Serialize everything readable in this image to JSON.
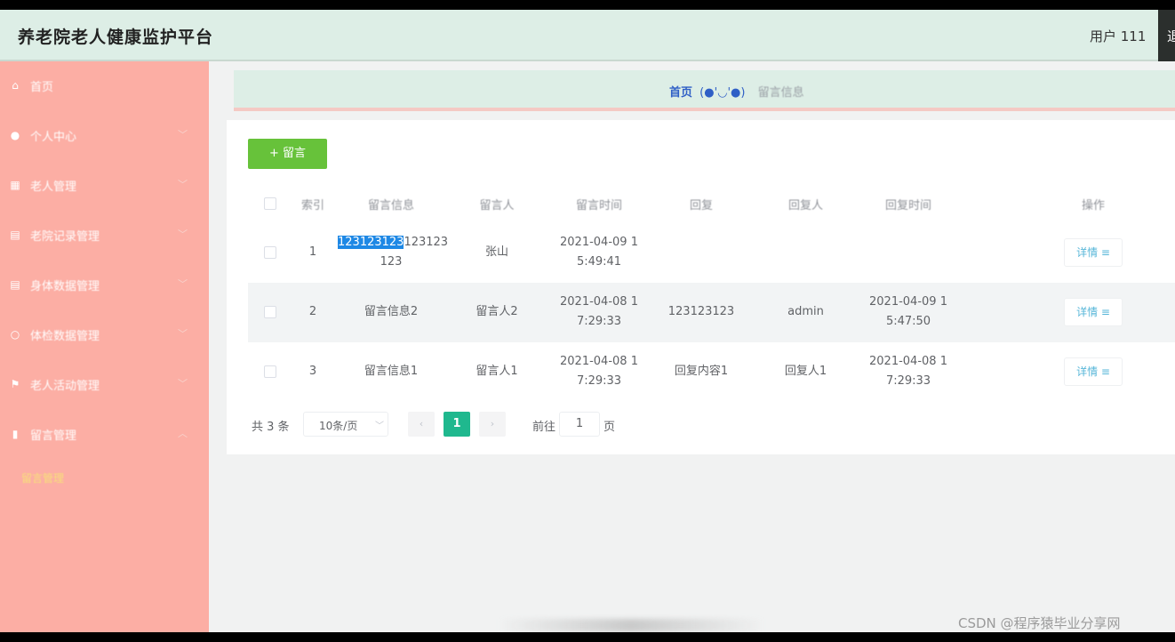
{
  "header": {
    "app_title": "养老院老人健康监护平台",
    "user_label": "用户 111",
    "logout_label": "退"
  },
  "sidebar": {
    "items": [
      {
        "label": "首页",
        "icon": "home-icon",
        "glyph": "⌂"
      },
      {
        "label": "个人中心",
        "icon": "user-icon",
        "glyph": "●"
      },
      {
        "label": "老人管理",
        "icon": "grid-icon",
        "glyph": "▦"
      },
      {
        "label": "老院记录管理",
        "icon": "document-icon",
        "glyph": "▤"
      },
      {
        "label": "身体数据管理",
        "icon": "document-icon",
        "glyph": "▤"
      },
      {
        "label": "体检数据管理",
        "icon": "circle-icon",
        "glyph": "○"
      },
      {
        "label": "老人活动管理",
        "icon": "flag-icon",
        "glyph": "⚑"
      },
      {
        "label": "留言管理",
        "icon": "chart-icon",
        "glyph": "▮"
      }
    ],
    "sub_item": "留言管理"
  },
  "breadcrumb": {
    "home": "首页",
    "face": "(●'◡'●)",
    "current": "留言信息"
  },
  "toolbar": {
    "add_label": "+ 留言"
  },
  "table": {
    "columns": [
      "索引",
      "留言信息",
      "留言人",
      "留言时间",
      "回复",
      "回复人",
      "回复时间",
      "操作"
    ],
    "rows": [
      {
        "index": "1",
        "message_sel": "123123123",
        "message_rest": "123123",
        "message_line2": "123",
        "author": "张山",
        "time1": "2021-04-09 1",
        "time2": "5:49:41",
        "reply": "",
        "replier": "",
        "rtime1": "",
        "rtime2": "",
        "action": "详情 ≡"
      },
      {
        "index": "2",
        "message_sel": "",
        "message_rest": "留言信息2",
        "message_line2": "",
        "author": "留言人2",
        "time1": "2021-04-08 1",
        "time2": "7:29:33",
        "reply": "123123123",
        "replier": "admin",
        "rtime1": "2021-04-09 1",
        "rtime2": "5:47:50",
        "action": "详情 ≡"
      },
      {
        "index": "3",
        "message_sel": "",
        "message_rest": "留言信息1",
        "message_line2": "",
        "author": "留言人1",
        "time1": "2021-04-08 1",
        "time2": "7:29:33",
        "reply": "回复内容1",
        "replier": "回复人1",
        "rtime1": "2021-04-08 1",
        "rtime2": "7:29:33",
        "action": "详情 ≡"
      }
    ]
  },
  "pagination": {
    "total": "共 3 条",
    "page_size": "10条/页",
    "current_page": "1",
    "goto_label": "前往",
    "goto_value": "1",
    "page_unit": "页"
  },
  "watermark": "CSDN @程序猿毕业分享网"
}
